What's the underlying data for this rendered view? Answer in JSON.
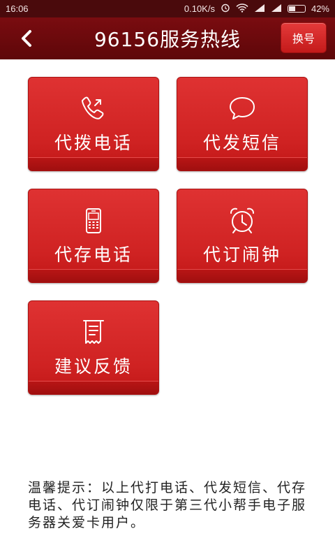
{
  "status_bar": {
    "time": "16:06",
    "network_speed": "0.10K/s",
    "battery_percent": "42%",
    "battery_level": 0.42,
    "icons": [
      "alarm-icon",
      "wifi-icon",
      "signal-icon",
      "signal-icon",
      "battery-icon"
    ]
  },
  "header": {
    "title": "96156服务热线",
    "switch_label": "换号"
  },
  "tiles": [
    {
      "label": "代拨电话",
      "icon": "phone-icon"
    },
    {
      "label": "代发短信",
      "icon": "chat-bubble-icon"
    },
    {
      "label": "代存电话",
      "icon": "mobile-phone-icon"
    },
    {
      "label": "代订闹钟",
      "icon": "alarm-clock-icon"
    },
    {
      "label": "建议反馈",
      "icon": "feedback-note-icon"
    }
  ],
  "notice": "温馨提示：以上代打电话、代发短信、代存电话、代订闹钟仅限于第三代小帮手电子服务器关爱卡用户。",
  "colors": {
    "header": "#6b0a0d",
    "tile": "#d42828",
    "text_on_tile": "#ffffff"
  }
}
